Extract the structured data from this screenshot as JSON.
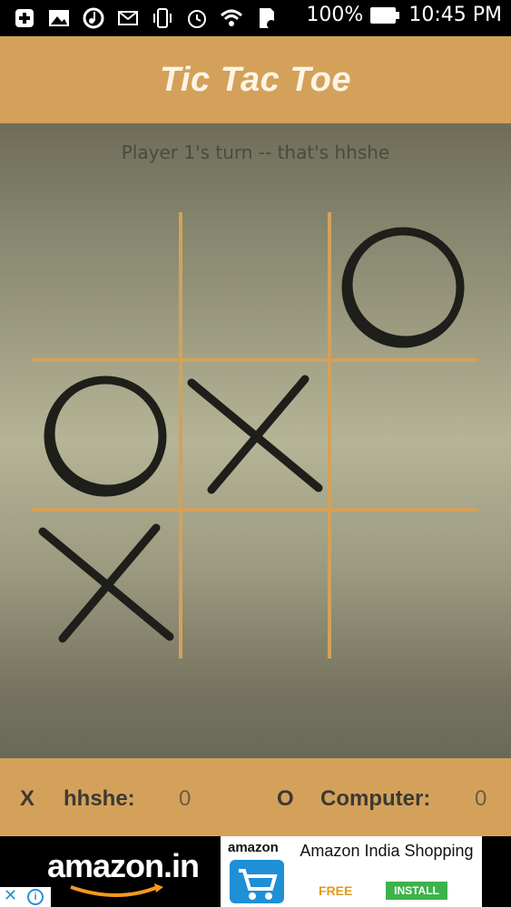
{
  "status_bar": {
    "battery": "100%",
    "time": "10:45 PM",
    "icons": [
      "add-icon",
      "image-icon",
      "music-icon",
      "mail-icon",
      "vibrate-icon",
      "alarm-icon",
      "wifi-icon",
      "sim-icon"
    ]
  },
  "app": {
    "title": "Tic Tac Toe",
    "turn_message": "Player 1's turn -- that's hhshe"
  },
  "board": {
    "cells": [
      "",
      "",
      "O",
      "O",
      "X",
      "",
      "X",
      "",
      ""
    ]
  },
  "score": {
    "player1_symbol": "X",
    "player1_name": "hhshe:",
    "player1_score": "0",
    "player2_symbol": "O",
    "player2_name": "Computer:",
    "player2_score": "0"
  },
  "ad": {
    "brand": "amazon.in",
    "icon_label": "amazon",
    "app_name": "Amazon India Shopping",
    "price": "FREE",
    "install": "INSTALL"
  },
  "colors": {
    "accent": "#d4a15a",
    "grid_line": "#d4a15a",
    "mark": "#1e1e1a"
  }
}
